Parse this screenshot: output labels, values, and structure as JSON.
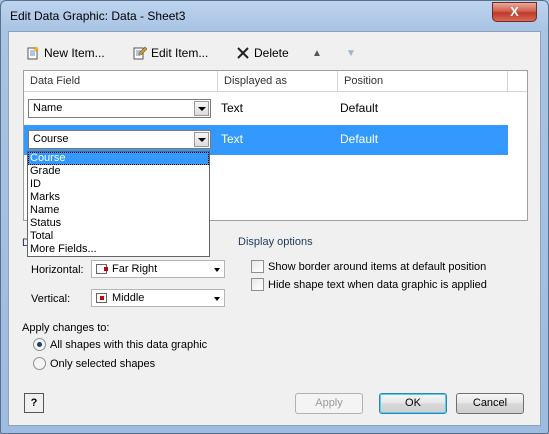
{
  "window": {
    "title": "Edit Data Graphic: Data - Sheet3",
    "close_glyph": "X"
  },
  "toolbar": {
    "new_item": "New Item...",
    "edit_item": "Edit Item...",
    "delete": "Delete",
    "move_up": "▲",
    "move_down": "▼"
  },
  "grid": {
    "headers": [
      "Data Field",
      "Displayed as",
      "Position"
    ],
    "rows": [
      {
        "field": "Name",
        "displayed_as": "Text",
        "position": "Default"
      },
      {
        "field": "Course",
        "displayed_as": "Text",
        "position": "Default"
      }
    ]
  },
  "dropdown": {
    "options": [
      "Course",
      "Grade",
      "ID",
      "Marks",
      "Name",
      "Status",
      "Total",
      "More Fields..."
    ],
    "highlighted": "Course"
  },
  "default_position": {
    "label_fragment": "D",
    "horizontal_label": "Horizontal:",
    "horizontal_value": "Far Right",
    "vertical_label": "Vertical:",
    "vertical_value": "Middle"
  },
  "display_options": {
    "title": "Display options",
    "border_label": "Show border around items at default position",
    "border_checked": false,
    "hide_text_label": "Hide shape text when data graphic is applied",
    "hide_text_checked": false
  },
  "apply_changes": {
    "title": "Apply changes to:",
    "opt_all": "All shapes with this data graphic",
    "opt_selected": "Only selected shapes",
    "selected": "all"
  },
  "buttons": {
    "help": "?",
    "apply": "Apply",
    "ok": "OK",
    "cancel": "Cancel"
  },
  "colors": {
    "selection": "#3399ff",
    "accent_red": "#c0000f"
  }
}
